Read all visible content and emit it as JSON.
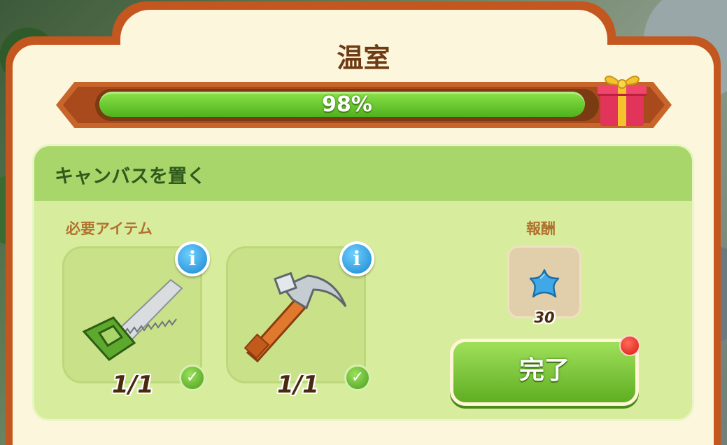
{
  "dialog": {
    "title": "温室",
    "progress": {
      "percent": 98,
      "label": "98%"
    }
  },
  "task": {
    "title": "キャンバスを置く",
    "required_label": "必要アイテム",
    "reward_label": "報酬",
    "items": [
      {
        "name": "saw",
        "count": "1/1",
        "completed": true
      },
      {
        "name": "hammer",
        "count": "1/1",
        "completed": true
      }
    ],
    "reward": {
      "icon": "blue-star-icon",
      "count": "30"
    },
    "complete_button": "完了"
  },
  "colors": {
    "frame": "#c4561f",
    "panel": "#fcf7dc",
    "progress_fill": "#5fc228",
    "task_header": "#a8d66a",
    "task_body": "#d8ec9e",
    "button_green": "#7cc83c",
    "title_brown": "#6e3b14"
  }
}
